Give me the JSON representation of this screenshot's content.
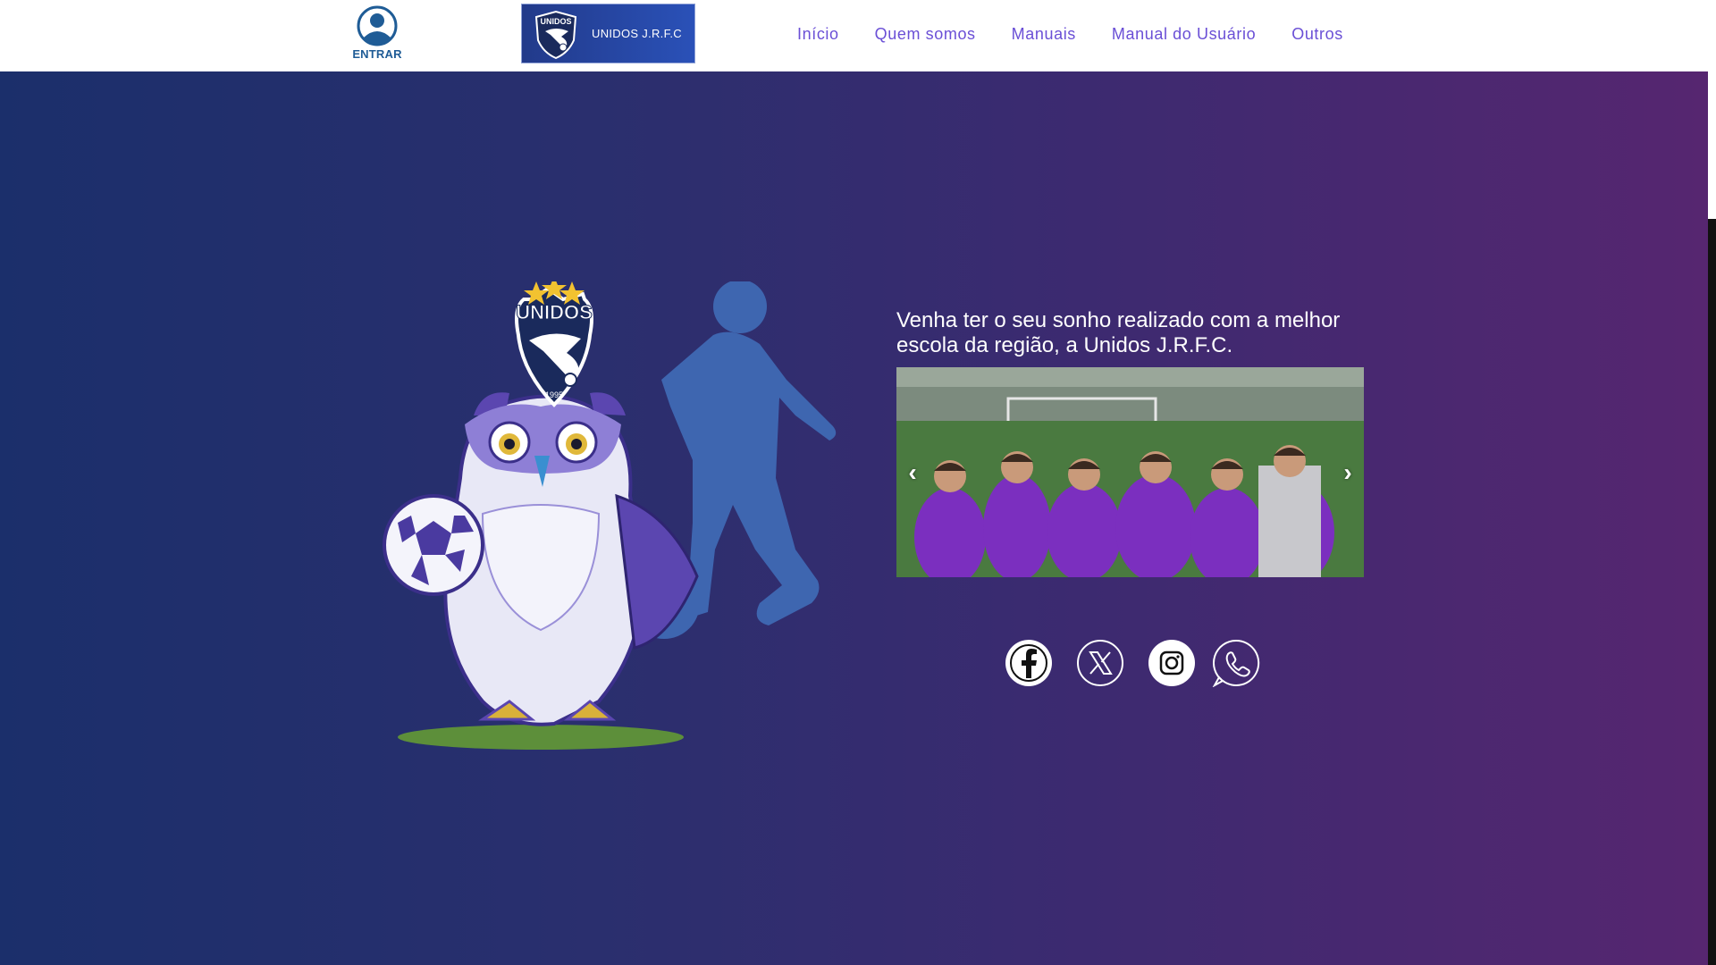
{
  "header": {
    "login_label": "ENTRAR",
    "brand_name": "UNIDOS J.R.F.C",
    "nav": [
      "Início",
      "Quem somos",
      "Manuais",
      "Manual do Usuário",
      "Outros"
    ]
  },
  "hero": {
    "tagline": "Venha ter o seu sonho realizado com a melhor escola da região, a Unidos J.R.F.C.",
    "crest_text": "UNIDOS",
    "crest_year": "1995",
    "carousel_prev": "‹",
    "carousel_next": "›"
  },
  "icons": {
    "login": "user-icon",
    "social": [
      "facebook-icon",
      "x-twitter-icon",
      "instagram-icon",
      "whatsapp-icon"
    ]
  },
  "colors": {
    "nav_link": "#6a4fd6",
    "login_blue": "#1f5c96",
    "hero_left": "#1b2f6b",
    "hero_right": "#562670"
  }
}
